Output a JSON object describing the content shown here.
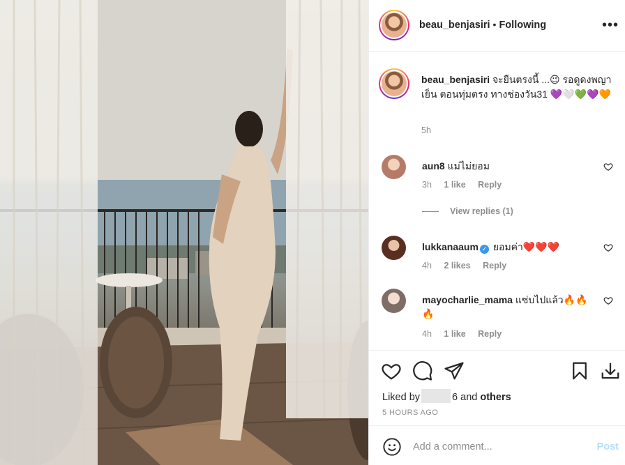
{
  "post": {
    "username": "beau_benjasiri",
    "follow_status": "Following",
    "more_icon": "more-horizontal-icon"
  },
  "caption": {
    "username": "beau_benjasiri",
    "text": "จะยืนตรงนี้ ...😉 รอดูดงพญาเย็น ตอนทุ่มตรง ทางช่องวัน31 💜🤍💚💜🧡",
    "time": "5h"
  },
  "comments": [
    {
      "username": "aun8",
      "text": "แม่ไม่ยอม",
      "time": "3h",
      "likes": "1 like",
      "reply": "Reply",
      "verified": false
    },
    {
      "username": "lukkanaaum",
      "text": "ยอมค่า❤️❤️❤️",
      "time": "4h",
      "likes": "2 likes",
      "reply": "Reply",
      "verified": true
    },
    {
      "username": "mayocharlie_mama",
      "text": "แซ่บไปแล้ว🔥🔥🔥",
      "time": "4h",
      "likes": "1 like",
      "reply": "Reply",
      "verified": false
    }
  ],
  "view_replies": "View replies (1)",
  "actions": {
    "liked_by_prefix": "Liked by",
    "liked_by_suffix": "6",
    "liked_by_and": "and",
    "liked_by_others": "others",
    "post_time": "5 HOURS AGO",
    "icons": [
      "heart-icon",
      "comment-icon",
      "share-icon",
      "bookmark-icon",
      "download-icon"
    ]
  },
  "add_comment": {
    "placeholder": "Add a comment...",
    "post_label": "Post"
  },
  "colors": {
    "text": "#262626",
    "muted": "#8e8e8e",
    "link_disabled": "#b2dffc",
    "verified": "#3897f0"
  }
}
